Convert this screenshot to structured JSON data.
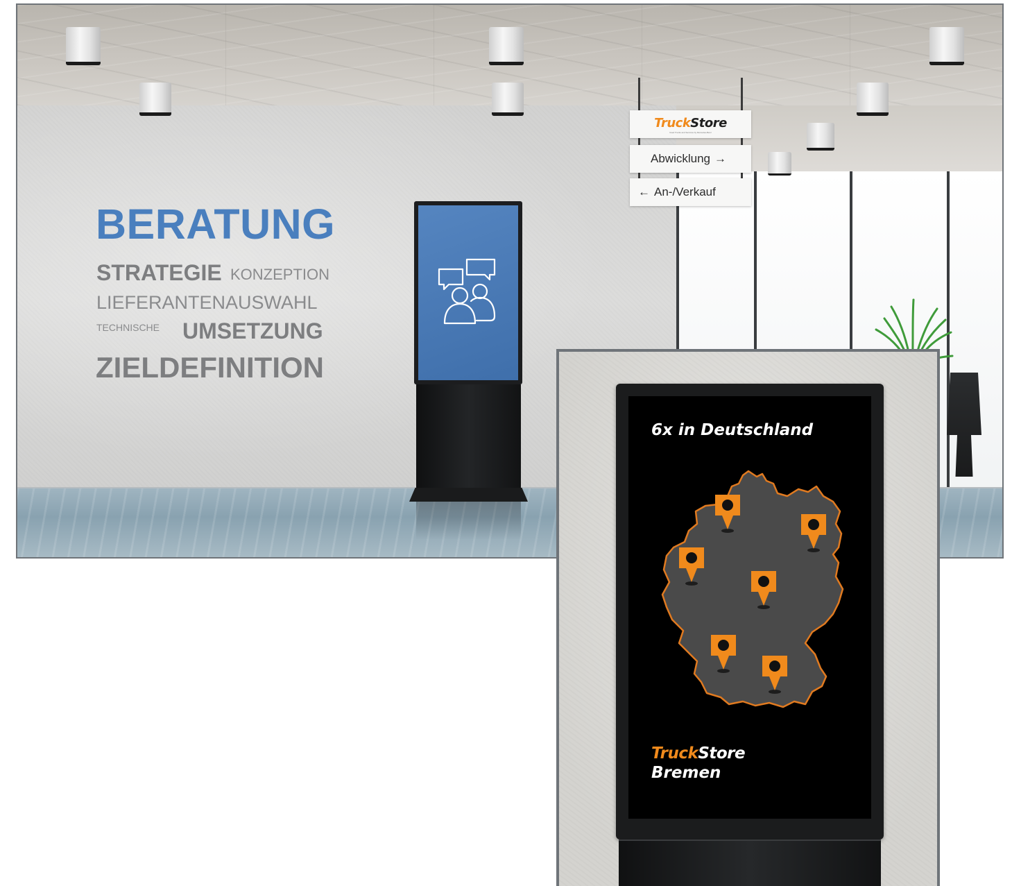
{
  "wall_words": {
    "beratung": "BERATUNG",
    "strategie": "STRATEGIE",
    "konzeption": "KONZEPTION",
    "lieferantenauswahl": "LIEFERANTENAUSWAHL",
    "technische": "TECHNISCHE",
    "umsetzung": "UMSETZUNG",
    "zieldefinition": "ZIELDEFINITION"
  },
  "sign": {
    "brand_truck": "Truck",
    "brand_store": "Store",
    "tagline": "Used Trucks and Services by Mercedes-Benz",
    "abwicklung": "Abwicklung",
    "abwicklung_arrow": "→",
    "an_verkauf": "An-/Verkauf",
    "an_verkauf_arrow": "←"
  },
  "inset_display": {
    "title": "6x in Deutschland",
    "brand_truck": "Truck",
    "brand_store": "Store",
    "city": "Bremen",
    "location_count": 6
  },
  "colors": {
    "accent_blue": "#4a7fbe",
    "brand_orange": "#f08a1c",
    "map_fill": "#4a4a4a"
  },
  "icons": {
    "kiosk_screen": "chat-people-icon",
    "map_marker": "map-pin-icon"
  }
}
